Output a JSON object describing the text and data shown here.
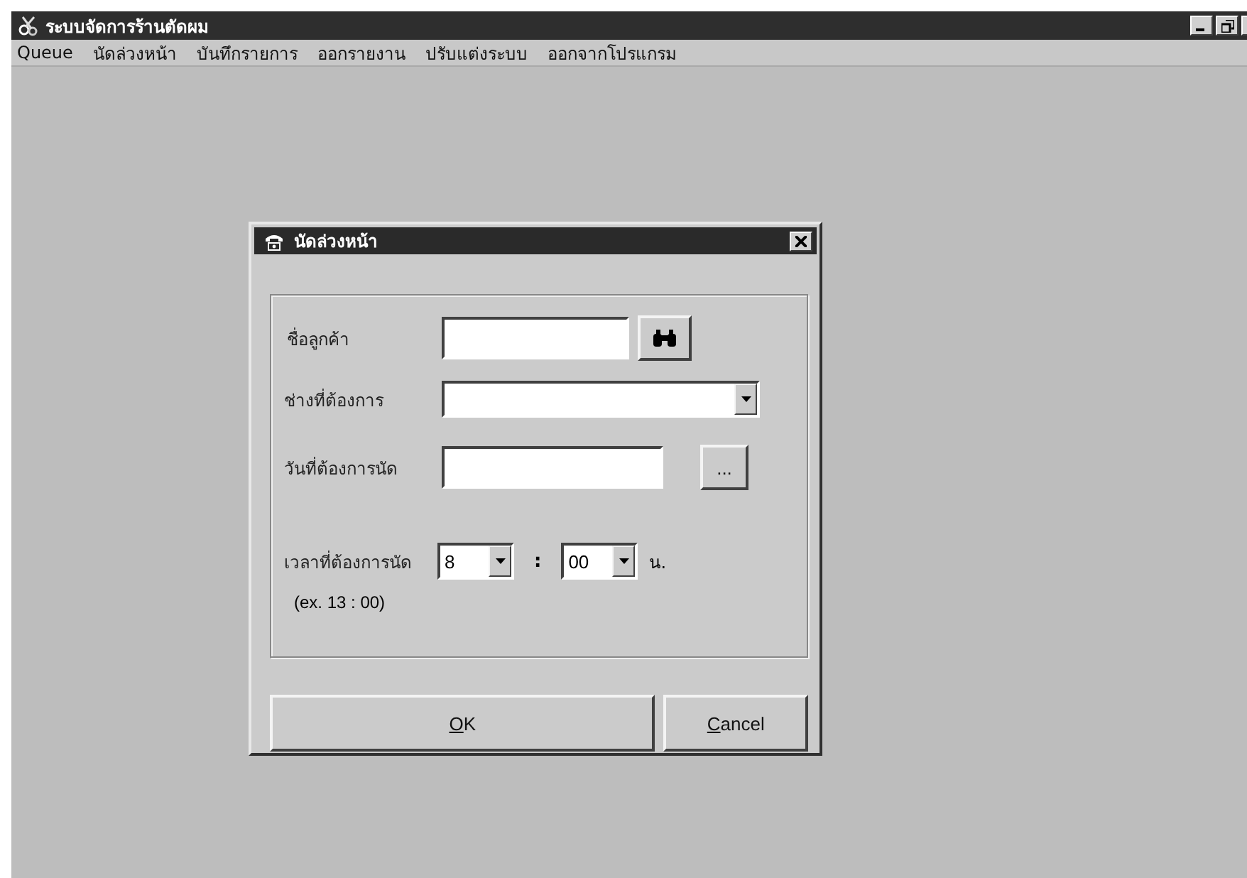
{
  "window": {
    "title": "ระบบจัดการร้านตัดผม"
  },
  "menu": [
    {
      "label": "Queue"
    },
    {
      "label": "นัดล่วงหน้า"
    },
    {
      "label": "บันทึกรายการ"
    },
    {
      "label": "ออกรายงาน"
    },
    {
      "label": "ปรับแต่งระบบ"
    },
    {
      "label": "ออกจากโปรแกรม"
    }
  ],
  "dialog": {
    "title": "นัดล่วงหน้า",
    "fields": [
      {
        "kind": "lookup",
        "label": "ชื่อลูกค้า"
      },
      {
        "kind": "dropdown",
        "label": "ช่างที่ต้องการ"
      },
      {
        "kind": "date",
        "label": "วันที่ต้องการนัด",
        "button": "..."
      },
      {
        "kind": "time",
        "label": "เวลาที่ต้องการนัด",
        "hour": "8",
        "separator": ":",
        "minute": "00",
        "unit": "น.",
        "hint": "(ex. 13 : 00)"
      }
    ],
    "buttons": [
      {
        "label": "OK",
        "underline_first": true
      },
      {
        "label": "Cancel",
        "underline_first": true
      }
    ]
  }
}
